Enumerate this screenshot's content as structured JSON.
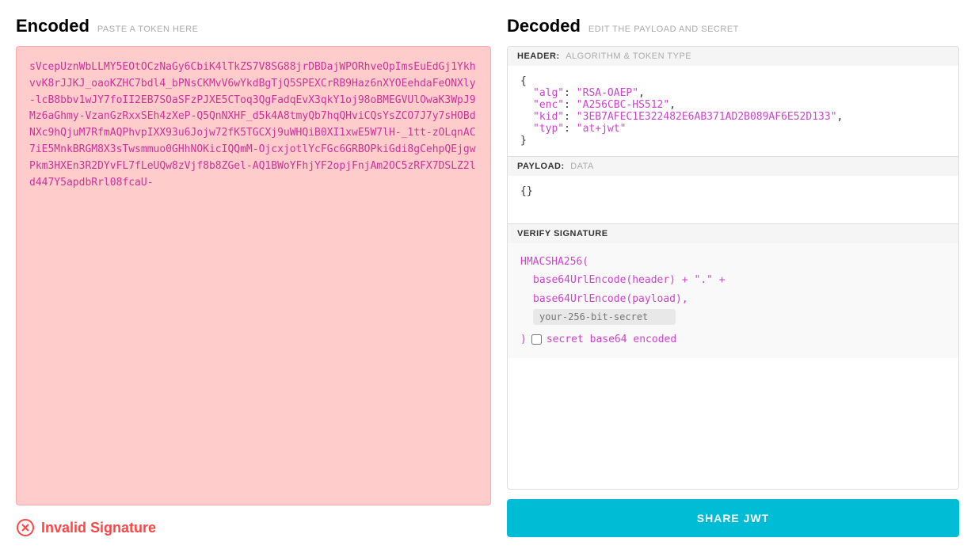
{
  "left": {
    "title": "Encoded",
    "subtitle": "PASTE A TOKEN HERE",
    "token": "sVcepUznWbLLMY5EOtOCzNaGy6CbiK4lTkZS7V8SG88jrDBDajWPORhveOpImsEuEdGj1YkhvvK8rJJKJ_oaoKZHC7bdl4_bPNsCKMvV6wYkdBgTjQ5SPEXCrRB9Haz6nXYOEehdaFeONXly-lcB8bbv1wJY7foII2EB7SOaSFzPJXE5CToq3QgFadqEvX3qkY1oj98oBMEGVUlOwaK3WpJ9Mz6aGhmy-VzanGzRxxSEh4zXeP-Q5QnNXHF_d5k4A8tmyQb7hqQHviCQsYsZCO7J7y7sHOBdNXc9hQjuM7RfmAQPhvpIXX93u6Jojw72fK5TGCXj9uWHQiB0XI1xwE5W7lH-_1tt-zOLqnAC7iE5MnkBRGM8X3sTwsmmuo0GHhNOKicIQQmM-OjcxjotlYcFGc6GRBOPkiGdi8gCehpQEjgwPkm3HXEn3R2DYvFL7fLeUQw8zVjf8b8ZGel-AQ1BWoYFhjYF2opjFnjAm2OC5zRFX7DSLZ2ld447Y5apdbRrl08fcaU-",
    "invalid_signature_label": "Invalid Signature"
  },
  "right": {
    "title": "Decoded",
    "subtitle": "EDIT THE PAYLOAD AND SECRET",
    "header_section": {
      "label": "HEADER:",
      "sub_label": "ALGORITHM & TOKEN TYPE",
      "json": {
        "alg": "RSA-OAEP",
        "enc": "A256CBC-HS512",
        "kid": "3EB7AFEC1E322482E6AB371AD2B089AF6E52D133",
        "typ": "at+jwt"
      }
    },
    "payload_section": {
      "label": "PAYLOAD:",
      "sub_label": "DATA",
      "json": "{}"
    },
    "verify_section": {
      "label": "VERIFY SIGNATURE",
      "line1": "HMACSHA256(",
      "line2": "base64UrlEncode(header) + \".\" +",
      "line3": "base64UrlEncode(payload),",
      "secret_placeholder": "your-256-bit-secret",
      "line4": ") ",
      "checkbox_label": "secret base64 encoded"
    },
    "share_button_label": "SHARE JWT"
  }
}
